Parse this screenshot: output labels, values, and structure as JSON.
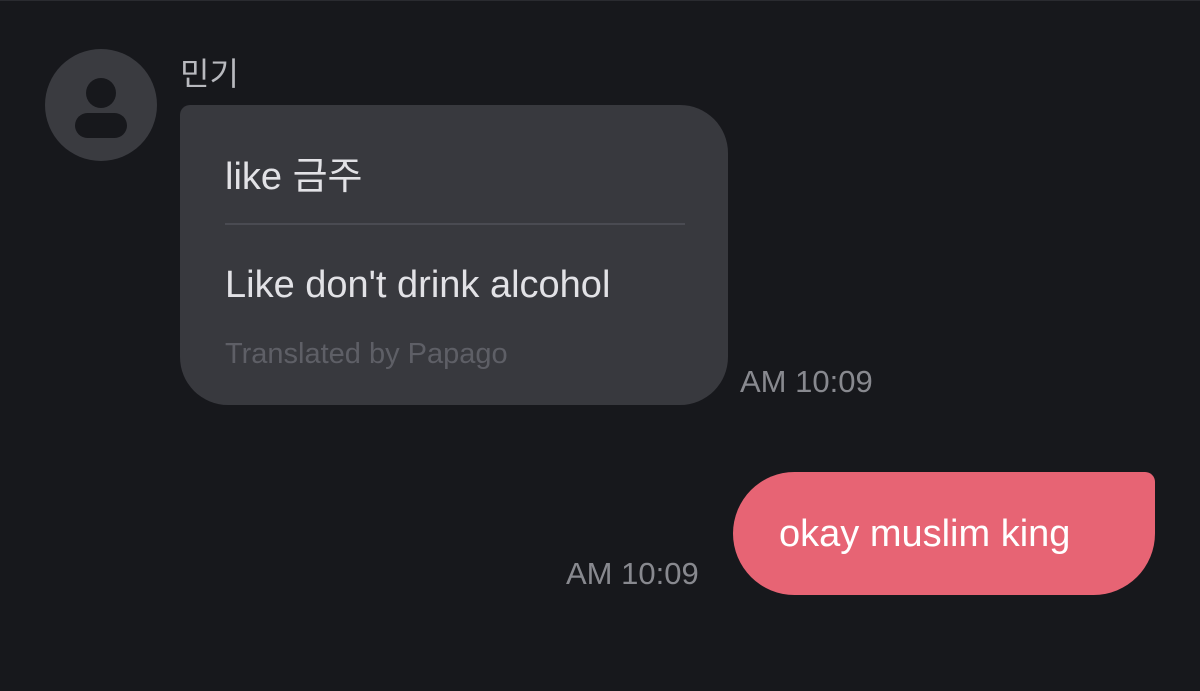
{
  "conversation": {
    "incoming": {
      "sender_name": "민기",
      "avatar_icon": "person-icon",
      "original_text": "like 금주",
      "translated_text": "Like don't drink alcohol",
      "translation_credit": "Translated by Papago",
      "timestamp": "AM 10:09"
    },
    "outgoing": {
      "text": "okay muslim king",
      "timestamp": "AM 10:09"
    }
  },
  "colors": {
    "background": "#17181c",
    "incoming_bubble": "#38393e",
    "outgoing_bubble": "#e76474",
    "avatar": "#3a3b40"
  }
}
